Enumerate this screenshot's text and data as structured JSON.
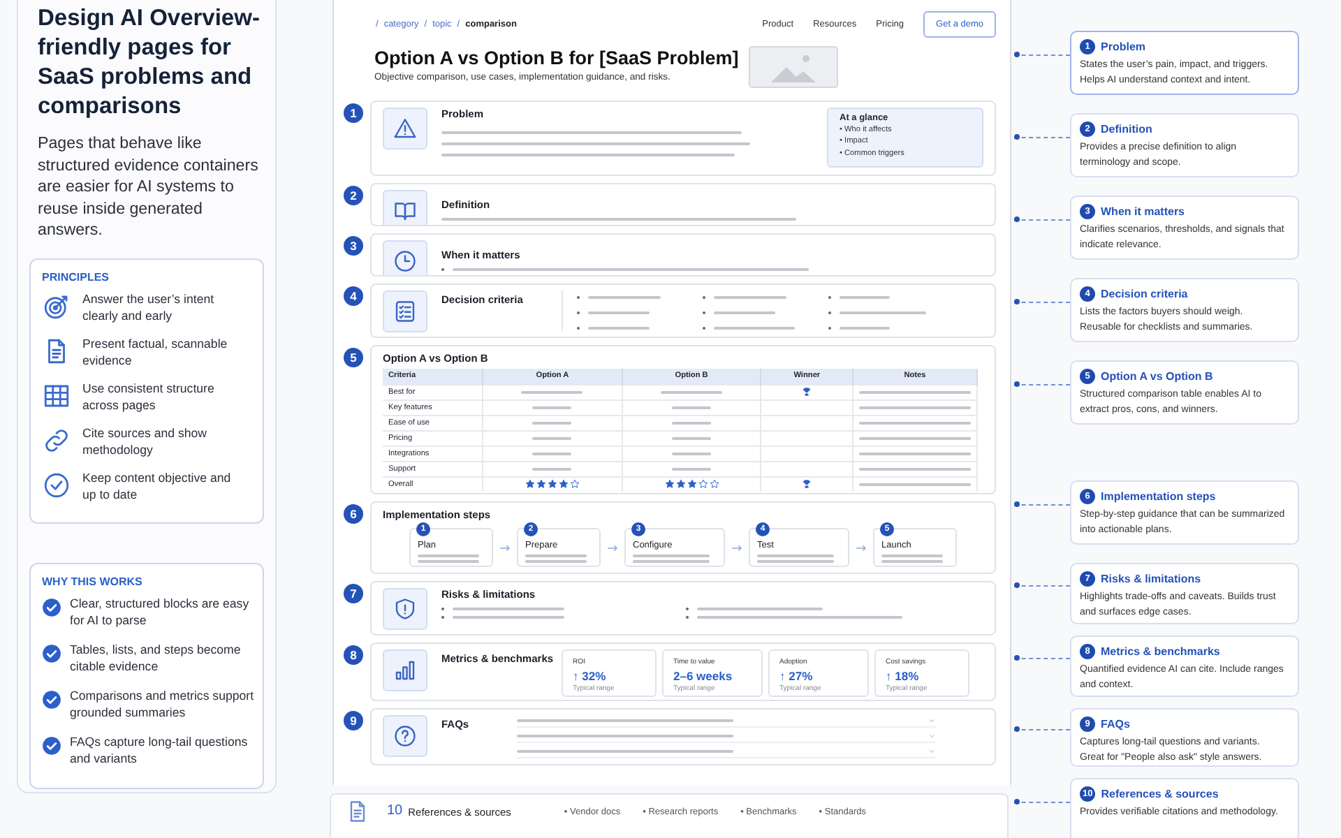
{
  "intro": {
    "title": "Design AI Overview-friendly pages for SaaS problems and comparisons",
    "description": "Pages that behave like structured evidence containers are easier for AI systems to reuse inside generated answers."
  },
  "principles": {
    "heading": "PRINCIPLES",
    "items": [
      {
        "kind": "target",
        "text": "Answer the user’s intent clearly and early"
      },
      {
        "kind": "document",
        "text": "Present factual, scannable evidence"
      },
      {
        "kind": "grid",
        "text": "Use consistent structure across pages"
      },
      {
        "kind": "link",
        "text": "Cite sources and show methodology"
      },
      {
        "kind": "check",
        "text": "Keep content objective and up to date"
      }
    ]
  },
  "why": {
    "heading": "WHY THIS WORKS",
    "items": [
      "Clear, structured blocks are easy for AI to parse",
      "Tables, lists, and steps become citable evidence",
      "Comparisons and metrics support grounded summaries",
      "FAQs capture long-tail questions and variants"
    ]
  },
  "page": {
    "breadcrumbs": [
      {
        "separator": "/",
        "label": "category",
        "current": false
      },
      {
        "separator": "/",
        "label": "topic",
        "current": false
      },
      {
        "separator": "/",
        "label": "comparison",
        "current": true
      }
    ],
    "nav": [
      "Product",
      "Resources",
      "Pricing"
    ],
    "cta": "Get a demo",
    "title": "Option A vs Option B for [SaaS Problem]",
    "subtitle": "Objective comparison, use cases, implementation guidance, and risks.",
    "sections": [
      {
        "number": "1",
        "kind": "summary",
        "title": "Problem",
        "aside": {
          "title": "At a glance",
          "items": [
            "• Who it affects",
            "• Impact",
            "• Common triggers"
          ]
        }
      },
      {
        "number": "2",
        "kind": "text",
        "title": "Definition"
      },
      {
        "number": "3",
        "kind": "bullets",
        "title": "When it matters"
      },
      {
        "number": "4",
        "kind": "criteria",
        "title": "Decision criteria"
      },
      {
        "number": "5",
        "kind": "table",
        "title": "Option A vs Option B",
        "columns": [
          "Criteria",
          "Option A",
          "Option B",
          "Winner",
          "Notes"
        ],
        "rows": [
          {
            "label": "Best for",
            "winner": true
          },
          {
            "label": "Key features",
            "winner": false
          },
          {
            "label": "Ease of use",
            "winner": false
          },
          {
            "label": "Pricing",
            "winner": false
          },
          {
            "label": "Integrations",
            "winner": false
          },
          {
            "label": "Support",
            "winner": false
          },
          {
            "label": "Overall",
            "winner": true,
            "option_a": {
              "stars": 4
            },
            "option_b": {
              "stars": 3
            }
          }
        ]
      },
      {
        "number": "6",
        "kind": "steps",
        "title": "Implementation steps",
        "steps": [
          {
            "number": "1",
            "label": "Plan"
          },
          {
            "number": "2",
            "label": "Prepare"
          },
          {
            "number": "3",
            "label": "Configure"
          },
          {
            "number": "4",
            "label": "Test"
          },
          {
            "number": "5",
            "label": "Launch"
          }
        ]
      },
      {
        "number": "7",
        "kind": "risks",
        "title": "Risks & limitations"
      },
      {
        "number": "8",
        "kind": "metrics",
        "title": "Metrics & benchmarks",
        "metrics": [
          {
            "label": "ROI",
            "value": "↑ 32%",
            "note": "Typical range"
          },
          {
            "label": "Time to value",
            "value": "2–6 weeks",
            "note": "Typical range"
          },
          {
            "label": "Adoption",
            "value": "↑ 27%",
            "note": "Typical range"
          },
          {
            "label": "Cost savings",
            "value": "↑ 18%",
            "note": "Typical range"
          }
        ]
      },
      {
        "number": "9",
        "kind": "faqs",
        "title": "FAQs"
      }
    ],
    "references": {
      "number": "10",
      "title": "References & sources",
      "items": [
        "• Vendor docs",
        "• Research reports",
        "• Benchmarks",
        "• Standards"
      ]
    }
  },
  "callouts": [
    {
      "number": "1",
      "title": "Problem",
      "text": "States the user’s pain, impact, and triggers. Helps AI understand context and intent.",
      "selected": true
    },
    {
      "number": "2",
      "title": "Definition",
      "text": "Provides a precise definition to align terminology and scope.",
      "selected": false
    },
    {
      "number": "3",
      "title": "When it matters",
      "text": "Clarifies scenarios, thresholds, and signals that indicate relevance.",
      "selected": false
    },
    {
      "number": "4",
      "title": "Decision criteria",
      "text": "Lists the factors buyers should weigh. Reusable for checklists and summaries.",
      "selected": false
    },
    {
      "number": "5",
      "title": "Option A vs Option B",
      "text": "Structured comparison table enables AI to extract pros, cons, and winners.",
      "selected": false
    },
    {
      "number": "6",
      "title": "Implementation steps",
      "text": "Step-by-step guidance that can be summarized into actionable plans.",
      "selected": false
    },
    {
      "number": "7",
      "title": "Risks & limitations",
      "text": "Highlights trade-offs and caveats. Builds trust and surfaces edge cases.",
      "selected": false
    },
    {
      "number": "8",
      "title": "Metrics & benchmarks",
      "text": "Quantified evidence AI can cite. Include ranges and context.",
      "selected": false
    },
    {
      "number": "9",
      "title": "FAQs",
      "text": "Captures long-tail questions and variants. Great for \"People also ask\" style answers.",
      "selected": false
    },
    {
      "number": "10",
      "title": "References & sources",
      "text": "Provides verifiable citations and methodology.",
      "selected": false
    }
  ]
}
